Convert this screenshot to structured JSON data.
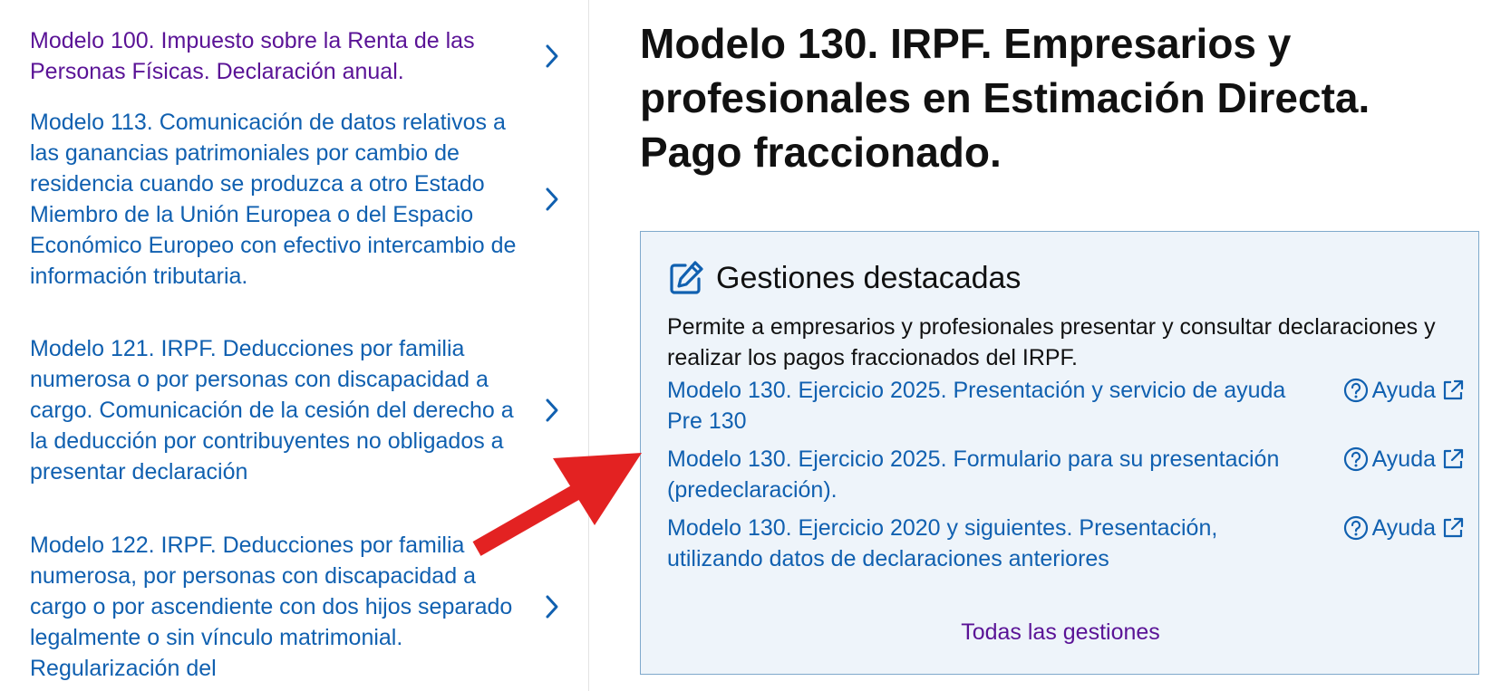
{
  "sidebar": {
    "items": [
      {
        "label": "Modelo 100. Impuesto sobre la Renta de las Personas Físicas. Declaración anual."
      },
      {
        "label": "Modelo 113. Comunicación de datos relativos a las ganancias patrimoniales por cambio de residencia cuando se produzca a otro Estado Miembro de la Unión Europea o del Espacio Económico Europeo con efectivo intercambio de información tributaria."
      },
      {
        "label": "Modelo 121. IRPF. Deducciones por familia numerosa o por personas con discapacidad a cargo. Comunicación de la cesión del derecho a la deducción por contribuyentes no obligados a presentar declaración"
      },
      {
        "label": "Modelo 122. IRPF. Deducciones por familia numerosa, por personas con discapacidad a cargo o por ascendiente con dos hijos separado legalmente o sin vínculo matrimonial. Regularización del"
      }
    ]
  },
  "main": {
    "title": "Modelo 130. IRPF. Empresarios y profesionales en Estimación Directa. Pago fraccionado.",
    "panel": {
      "title": "Gestiones destacadas",
      "description": "Permite a empresarios y profesionales presentar y consultar declaraciones y realizar los pagos fraccionados del IRPF.",
      "gestiones": [
        {
          "label": "Modelo 130. Ejercicio 2025. Presentación y servicio de ayuda Pre 130",
          "help": "Ayuda"
        },
        {
          "label": "Modelo 130. Ejercicio 2025. Formulario para su presentación (predeclaración).",
          "help": "Ayuda"
        },
        {
          "label": "Modelo 130. Ejercicio 2020 y siguientes. Presentación, utilizando datos de declaraciones anteriores",
          "help": "Ayuda"
        }
      ],
      "all_link": "Todas las gestiones"
    }
  },
  "colors": {
    "link": "#1060b0",
    "visited": "#5a1396",
    "panel_bg": "#eef4fa",
    "panel_border": "#7fa9cc",
    "annotation": "#e32222"
  },
  "icons": {
    "nav_chevron": "chevron-right-icon",
    "panel_icon": "edit-pen-icon",
    "help": "question-circle-icon",
    "external": "external-link-icon"
  }
}
